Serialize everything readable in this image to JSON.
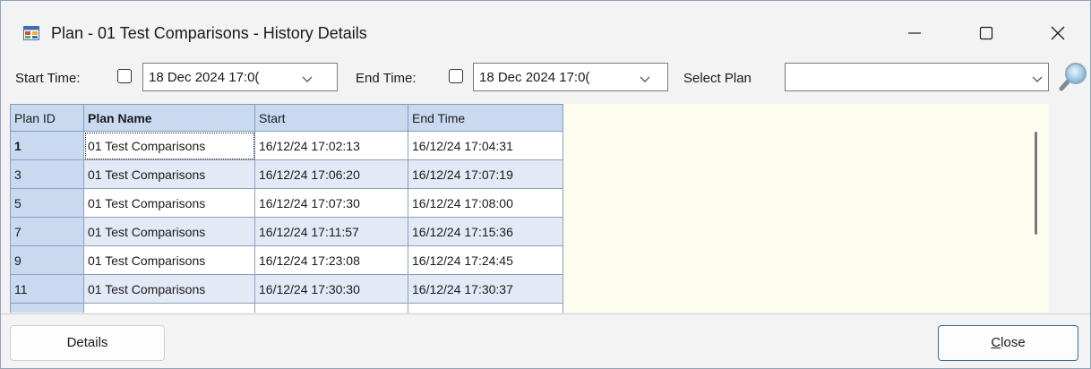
{
  "window": {
    "title": "Plan - 01 Test Comparisons - History Details"
  },
  "filters": {
    "start_label": "Start Time:",
    "start_value": "18 Dec 2024 17:0(",
    "end_label": "End Time:",
    "end_value": "18 Dec 2024 17:0(",
    "plan_label": "Select Plan",
    "plan_value": ""
  },
  "grid": {
    "columns": [
      "Plan ID",
      "Plan Name",
      "Start",
      "End Time"
    ],
    "rows": [
      [
        "1",
        "01 Test Comparisons",
        "16/12/24 17:02:13",
        "16/12/24 17:04:31"
      ],
      [
        "3",
        "01 Test Comparisons",
        "16/12/24 17:06:20",
        "16/12/24 17:07:19"
      ],
      [
        "5",
        "01 Test Comparisons",
        "16/12/24 17:07:30",
        "16/12/24 17:08:00"
      ],
      [
        "7",
        "01 Test Comparisons",
        "16/12/24 17:11:57",
        "16/12/24 17:15:36"
      ],
      [
        "9",
        "01 Test Comparisons",
        "16/12/24 17:23:08",
        "16/12/24 17:24:45"
      ],
      [
        "11",
        "01 Test Comparisons",
        "16/12/24 17:30:30",
        "16/12/24 17:30:37"
      ]
    ]
  },
  "footer": {
    "details_label": "Details",
    "close_first": "C",
    "close_rest": "lose"
  },
  "icons": {
    "app": "application-icon",
    "minimize": "minimize-icon",
    "maximize": "maximize-icon",
    "close": "close-icon",
    "search": "magnifier-icon"
  },
  "colors": {
    "header_bg": "#c9daf0",
    "alt_row_bg": "#e4e9f6",
    "grid_bg": "#fefef0",
    "accent_border": "#2f6ea8"
  }
}
